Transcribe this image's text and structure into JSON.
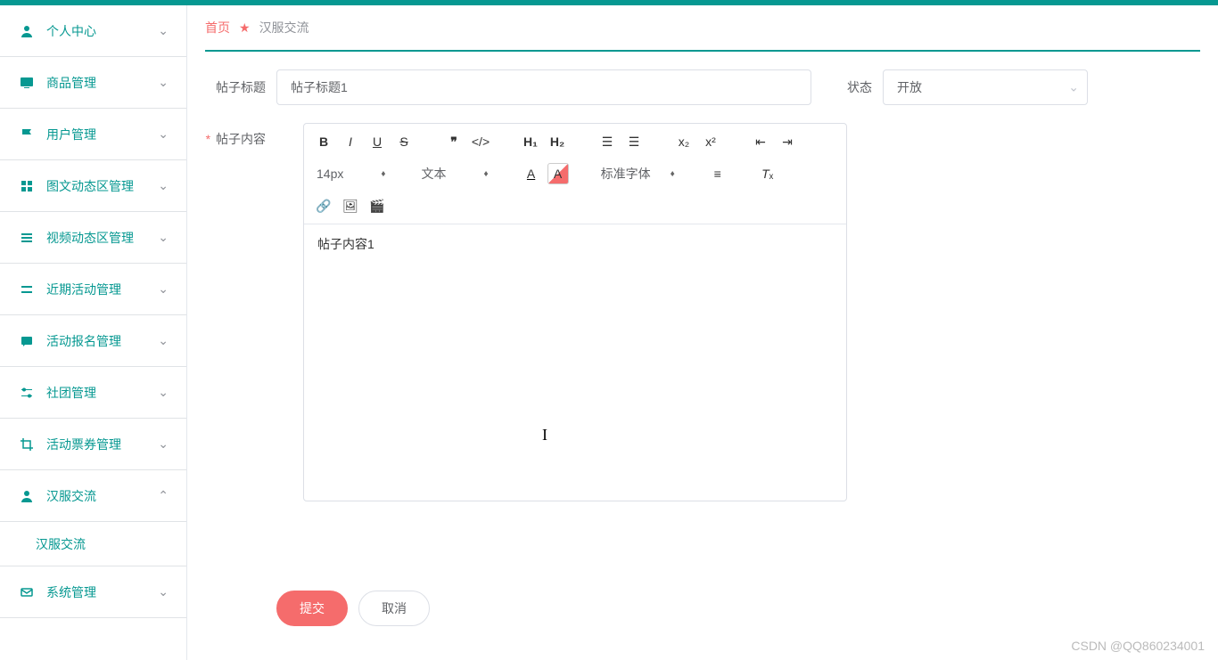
{
  "breadcrumb": {
    "home": "首页",
    "current": "汉服交流"
  },
  "sidebar": {
    "items": [
      {
        "label": "个人中心",
        "expanded": false
      },
      {
        "label": "商品管理",
        "expanded": false
      },
      {
        "label": "用户管理",
        "expanded": false
      },
      {
        "label": "图文动态区管理",
        "expanded": false
      },
      {
        "label": "视频动态区管理",
        "expanded": false
      },
      {
        "label": "近期活动管理",
        "expanded": false
      },
      {
        "label": "活动报名管理",
        "expanded": false
      },
      {
        "label": "社团管理",
        "expanded": false
      },
      {
        "label": "活动票券管理",
        "expanded": false
      },
      {
        "label": "汉服交流",
        "expanded": true,
        "sub": [
          {
            "label": "汉服交流"
          }
        ]
      },
      {
        "label": "系统管理",
        "expanded": false
      }
    ]
  },
  "form": {
    "title_label": "帖子标题",
    "title_value": "帖子标题1",
    "status_label": "状态",
    "status_value": "开放",
    "content_label": "帖子内容",
    "content_value": "帖子内容1"
  },
  "editor": {
    "font_size": "14px",
    "font_type": "文本",
    "font_family": "标准字体"
  },
  "buttons": {
    "submit": "提交",
    "cancel": "取消"
  },
  "watermark": "CSDN @QQ860234001"
}
